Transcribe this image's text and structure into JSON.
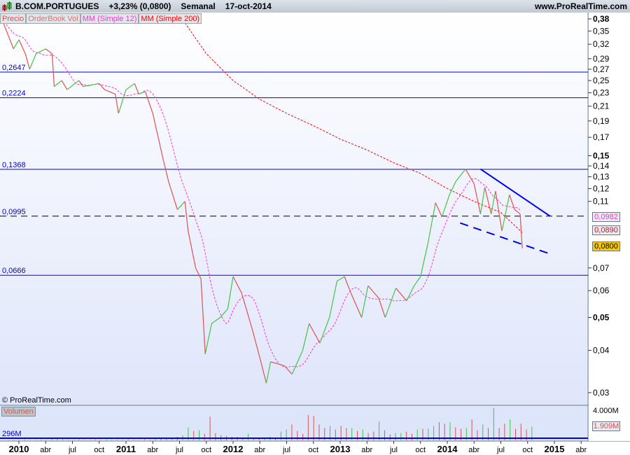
{
  "header": {
    "symbol": "B.COM.PORTUGUES",
    "change": "+3,23% (0,0800)",
    "period": "Semanal",
    "date": "17-oct-2014",
    "site": "www.ProRealTime.com"
  },
  "legend": {
    "price": "Precio",
    "orderbook": "OrderBook Vol",
    "ma12": "MM (Simple 12)",
    "ma200": "MM (Simple 200)"
  },
  "watermark": "© ProRealTime.com",
  "volume_panel": {
    "label": "Volumen",
    "baseline_label": "296M",
    "tick": "4.000M",
    "last": "1.909M"
  },
  "price_labels": {
    "ma12": "0,0982",
    "ma200": "0,0890",
    "last": "0,0800"
  },
  "colors": {
    "up": "#44c444",
    "down": "#e05050",
    "ma12": "#ff33cc",
    "ma200": "#ff0000",
    "levels": "#0000dd",
    "last_bg": "#f8c800"
  },
  "chart_data": {
    "type": "line",
    "title": "B.COM.PORTUGUES Semanal",
    "scale": "log",
    "ylim": [
      0.029,
      0.39
    ],
    "xlim": [
      2009.84,
      2015.42
    ],
    "yticks": [
      {
        "v": 0.38,
        "l": "0,38",
        "b": true
      },
      {
        "v": 0.35,
        "l": "0,35"
      },
      {
        "v": 0.32,
        "l": "0,32"
      },
      {
        "v": 0.29,
        "l": "0,29"
      },
      {
        "v": 0.27,
        "l": "0,27"
      },
      {
        "v": 0.25,
        "l": "0,25"
      },
      {
        "v": 0.23,
        "l": "0,23"
      },
      {
        "v": 0.21,
        "l": "0,21"
      },
      {
        "v": 0.19,
        "l": "0,19"
      },
      {
        "v": 0.17,
        "l": "0,17"
      },
      {
        "v": 0.15,
        "l": "0,15",
        "b": true
      },
      {
        "v": 0.14,
        "l": "0,14"
      },
      {
        "v": 0.13,
        "l": "0,13"
      },
      {
        "v": 0.12,
        "l": "0,12"
      },
      {
        "v": 0.11,
        "l": "0,11"
      },
      {
        "v": 0.07,
        "l": "0,07"
      },
      {
        "v": 0.06,
        "l": "0,06"
      },
      {
        "v": 0.05,
        "l": "0,05",
        "b": true
      },
      {
        "v": 0.04,
        "l": "0,04"
      },
      {
        "v": 0.03,
        "l": "0,03"
      }
    ],
    "xticks": [
      {
        "v": 2010,
        "l": "2010",
        "b": true
      },
      {
        "v": 2010.25,
        "l": "abr"
      },
      {
        "v": 2010.5,
        "l": "jul"
      },
      {
        "v": 2010.75,
        "l": "oct"
      },
      {
        "v": 2011,
        "l": "2011",
        "b": true
      },
      {
        "v": 2011.25,
        "l": "abr"
      },
      {
        "v": 2011.5,
        "l": "jul"
      },
      {
        "v": 2011.75,
        "l": "oct"
      },
      {
        "v": 2012,
        "l": "2012",
        "b": true
      },
      {
        "v": 2012.25,
        "l": "abr"
      },
      {
        "v": 2012.5,
        "l": "jul"
      },
      {
        "v": 2012.75,
        "l": "oct"
      },
      {
        "v": 2013,
        "l": "2013",
        "b": true
      },
      {
        "v": 2013.25,
        "l": "abr"
      },
      {
        "v": 2013.5,
        "l": "jul"
      },
      {
        "v": 2013.75,
        "l": "oct"
      },
      {
        "v": 2014,
        "l": "2014",
        "b": true
      },
      {
        "v": 2014.25,
        "l": "abr"
      },
      {
        "v": 2014.5,
        "l": "jul"
      },
      {
        "v": 2014.75,
        "l": "oct"
      },
      {
        "v": 2015,
        "l": "2015",
        "b": true
      },
      {
        "v": 2015.25,
        "l": "abr"
      }
    ],
    "levels": [
      {
        "v": 0.2647,
        "l": "0,2647"
      },
      {
        "v": 0.2224,
        "l": "0,2224"
      },
      {
        "v": 0.1368,
        "l": "0,1368"
      },
      {
        "v": 0.0995,
        "l": "0,0995",
        "dashed": true
      },
      {
        "v": 0.0666,
        "l": "0,0666"
      }
    ],
    "trendlines": [
      {
        "from": [
          2014.31,
          0.137
        ],
        "to": [
          2014.96,
          0.0995
        ],
        "dashed": false
      },
      {
        "from": [
          2014.12,
          0.095
        ],
        "to": [
          2014.96,
          0.077
        ],
        "dashed": true
      }
    ],
    "price": [
      [
        2009.84,
        0.38
      ],
      [
        2009.9,
        0.34
      ],
      [
        2009.95,
        0.31
      ],
      [
        2010.0,
        0.33
      ],
      [
        2010.06,
        0.3
      ],
      [
        2010.1,
        0.27
      ],
      [
        2010.16,
        0.3
      ],
      [
        2010.25,
        0.31
      ],
      [
        2010.31,
        0.3
      ],
      [
        2010.33,
        0.24
      ],
      [
        2010.4,
        0.25
      ],
      [
        2010.45,
        0.235
      ],
      [
        2010.56,
        0.25
      ],
      [
        2010.6,
        0.24
      ],
      [
        2010.75,
        0.245
      ],
      [
        2010.8,
        0.235
      ],
      [
        2010.9,
        0.228
      ],
      [
        2010.93,
        0.2
      ],
      [
        2011.0,
        0.235
      ],
      [
        2011.08,
        0.245
      ],
      [
        2011.12,
        0.228
      ],
      [
        2011.18,
        0.232
      ],
      [
        2011.25,
        0.2
      ],
      [
        2011.35,
        0.145
      ],
      [
        2011.4,
        0.125
      ],
      [
        2011.48,
        0.104
      ],
      [
        2011.55,
        0.11
      ],
      [
        2011.58,
        0.09
      ],
      [
        2011.65,
        0.07
      ],
      [
        2011.7,
        0.065
      ],
      [
        2011.74,
        0.039
      ],
      [
        2011.8,
        0.048
      ],
      [
        2011.88,
        0.05
      ],
      [
        2011.95,
        0.053
      ],
      [
        2012.0,
        0.066
      ],
      [
        2012.08,
        0.059
      ],
      [
        2012.18,
        0.046
      ],
      [
        2012.25,
        0.038
      ],
      [
        2012.31,
        0.032
      ],
      [
        2012.35,
        0.037
      ],
      [
        2012.48,
        0.036
      ],
      [
        2012.55,
        0.034
      ],
      [
        2012.65,
        0.04
      ],
      [
        2012.71,
        0.048
      ],
      [
        2012.81,
        0.042
      ],
      [
        2012.9,
        0.05
      ],
      [
        2012.97,
        0.064
      ],
      [
        2013.04,
        0.066
      ],
      [
        2013.1,
        0.059
      ],
      [
        2013.2,
        0.05
      ],
      [
        2013.26,
        0.062
      ],
      [
        2013.36,
        0.057
      ],
      [
        2013.42,
        0.05
      ],
      [
        2013.52,
        0.061
      ],
      [
        2013.62,
        0.056
      ],
      [
        2013.69,
        0.062
      ],
      [
        2013.75,
        0.066
      ],
      [
        2013.82,
        0.083
      ],
      [
        2013.89,
        0.109
      ],
      [
        2013.95,
        0.099
      ],
      [
        2014.02,
        0.115
      ],
      [
        2014.08,
        0.126
      ],
      [
        2014.17,
        0.137
      ],
      [
        2014.25,
        0.124
      ],
      [
        2014.31,
        0.101
      ],
      [
        2014.35,
        0.121
      ],
      [
        2014.41,
        0.101
      ],
      [
        2014.45,
        0.118
      ],
      [
        2014.51,
        0.09
      ],
      [
        2014.58,
        0.115
      ],
      [
        2014.63,
        0.104
      ],
      [
        2014.68,
        0.101
      ],
      [
        2014.7,
        0.08
      ]
    ],
    "ma200": [
      [
        2011.55,
        0.37
      ],
      [
        2011.75,
        0.3
      ],
      [
        2012.0,
        0.25
      ],
      [
        2012.25,
        0.22
      ],
      [
        2012.5,
        0.2
      ],
      [
        2012.75,
        0.184
      ],
      [
        2013.0,
        0.168
      ],
      [
        2013.25,
        0.156
      ],
      [
        2013.5,
        0.143
      ],
      [
        2013.75,
        0.133
      ],
      [
        2014.0,
        0.12
      ],
      [
        2014.25,
        0.11
      ],
      [
        2014.5,
        0.102
      ],
      [
        2014.7,
        0.089
      ]
    ],
    "volume": [
      60,
      40,
      90,
      120,
      50,
      30,
      70,
      40,
      200,
      380,
      150,
      90,
      60,
      140,
      80,
      50,
      110,
      70,
      120,
      60,
      90,
      50,
      130,
      80,
      60,
      150,
      90,
      200,
      300,
      250,
      380,
      500,
      700,
      1800,
      1300,
      1400,
      900,
      3300,
      1000,
      700,
      600,
      500,
      450,
      400,
      900,
      300,
      200,
      300,
      500,
      250,
      1200,
      1500,
      2200,
      1300,
      900,
      3500,
      3400,
      2200,
      1700,
      2000,
      1500,
      2000,
      1700,
      1700,
      1300,
      1500,
      1000,
      1200,
      2600,
      1400,
      800,
      1000,
      1000,
      1200,
      900,
      1500,
      1600,
      1600,
      2000,
      2500,
      2300,
      2500,
      1800,
      1600,
      1700,
      2900,
      1400,
      2200,
      1700,
      4500,
      1700,
      2300,
      2900,
      1600,
      2300,
      1500,
      1909
    ]
  }
}
